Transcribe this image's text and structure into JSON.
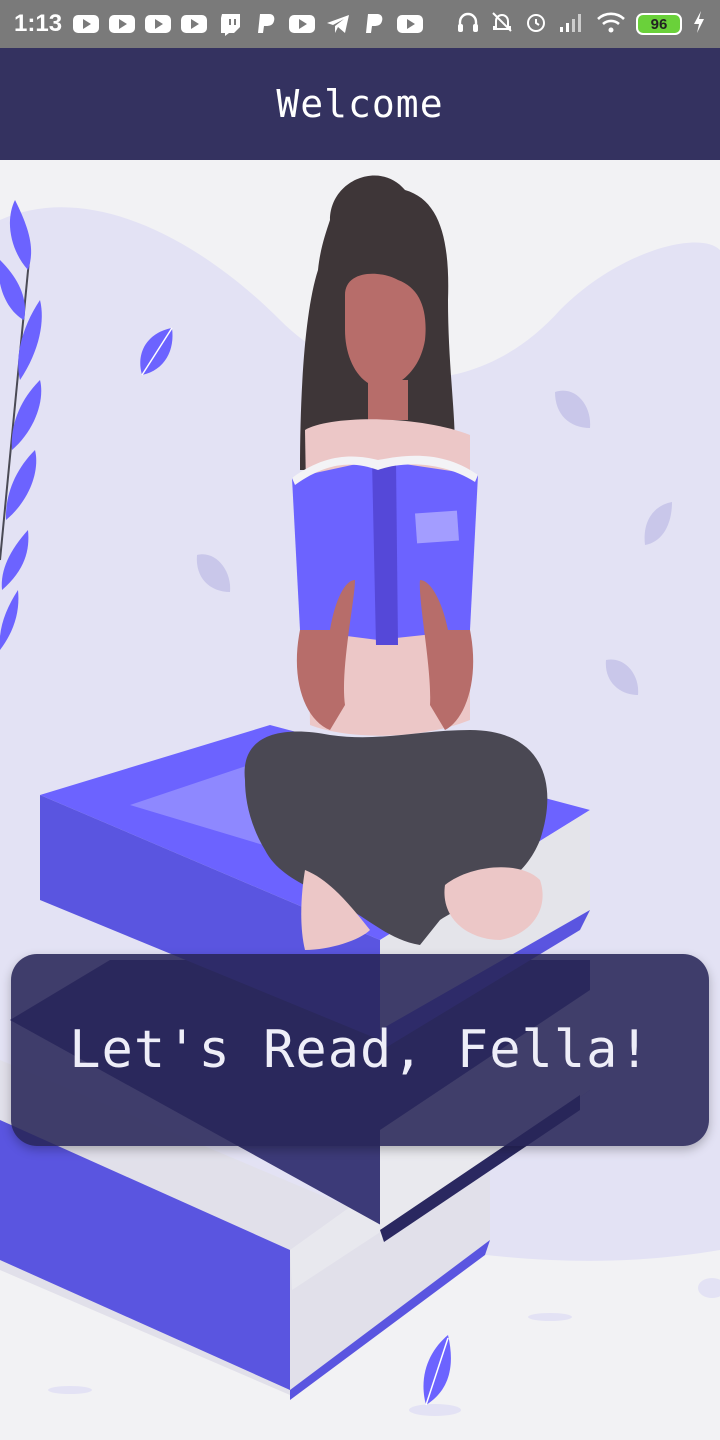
{
  "status_bar": {
    "time": "1:13",
    "battery_level": "96",
    "notification_icons": [
      "youtube-icon",
      "youtube-icon",
      "youtube-icon",
      "youtube-icon",
      "twitch-icon",
      "paypal-icon",
      "youtube-icon",
      "telegram-icon",
      "paypal-icon",
      "youtube-icon"
    ],
    "right_icons": [
      "headset-icon",
      "bell-off-icon",
      "alarm-icon",
      "signal-icon",
      "wifi-icon",
      "battery-icon",
      "charging-icon"
    ]
  },
  "app_bar": {
    "title": "Welcome"
  },
  "hero": {
    "cta_label": "Let's Read, Fella!"
  },
  "colors": {
    "app_bar": "#343260",
    "accent": "#6c63ff",
    "background": "#f2f2f4",
    "card": "#282658"
  }
}
